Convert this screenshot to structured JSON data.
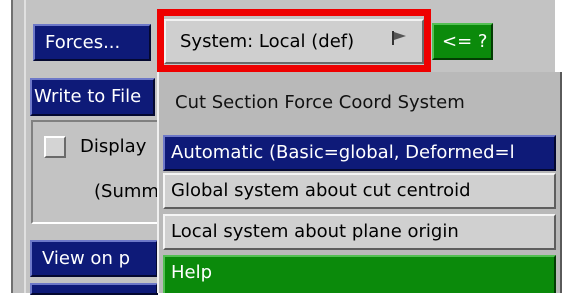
{
  "panel": {
    "forces_label": "Forces...",
    "system_button_label": "System: Local (def)",
    "query_button_label": "<= ?",
    "write_to_file_label": "Write to File",
    "display_label": "Display",
    "summary_label": "(Summ",
    "view_on_plane_label": "View on p"
  },
  "menu": {
    "title": "Cut Section Force Coord System",
    "items": [
      {
        "label": "Automatic (Basic=global, Deformed=l",
        "selected": true
      },
      {
        "label": "Global system about cut centroid",
        "selected": false
      },
      {
        "label": "Local system about plane origin",
        "selected": false
      },
      {
        "label": "Help",
        "selected": false
      }
    ]
  },
  "icons": {
    "system_dropdown_icon": "flag-icon"
  },
  "colors": {
    "navy": "#0e1a78",
    "green": "#0b8a0b",
    "highlight_red": "#ee0000",
    "panel_grey": "#c0c0c0"
  }
}
